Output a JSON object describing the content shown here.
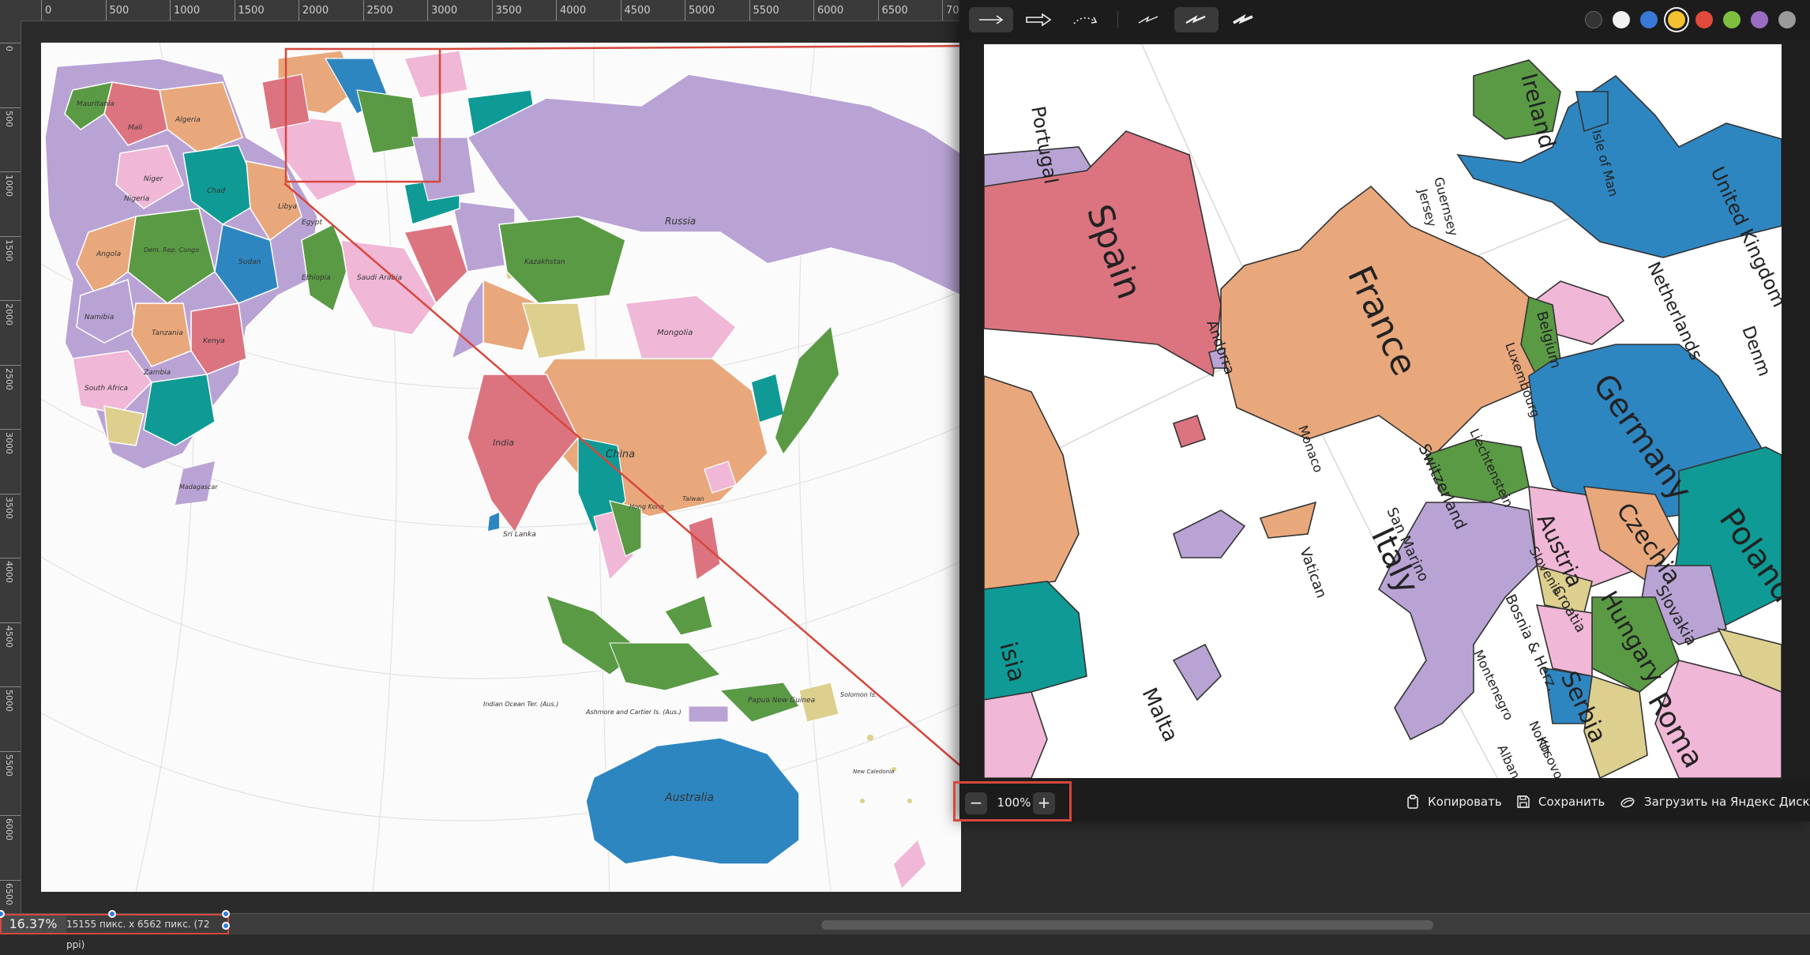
{
  "ruler": {
    "top_labels": [
      "0",
      "500",
      "1000",
      "1500",
      "2000",
      "2500",
      "3000",
      "3500",
      "4000",
      "4500",
      "5000",
      "5500",
      "6000",
      "6500",
      "70"
    ],
    "left_labels": [
      "0",
      "500",
      "1000",
      "1500",
      "2000",
      "2500",
      "3000",
      "3500",
      "4000",
      "4500",
      "5000",
      "5500",
      "6000",
      "6500"
    ]
  },
  "status": {
    "zoom": "16.37%",
    "doc_info": "15155 пикс. x 6562 пикс. (72 ppi)"
  },
  "map_labels": {
    "russia": "Russia",
    "china": "China",
    "india": "India",
    "mongolia": "Mongolia",
    "australia": "Australia",
    "kazakhstan": "Kazakhstan",
    "saudi_arabia": "Saudi Arabia",
    "algeria": "Algeria",
    "mali": "Mali",
    "niger": "Niger",
    "chad": "Chad",
    "sudan": "Sudan",
    "libya": "Libya",
    "egypt": "Egypt",
    "ethiopia": "Ethiopia",
    "kenya": "Kenya",
    "tanzania": "Tanzania",
    "angola": "Angola",
    "zambia": "Zambia",
    "namibia": "Namibia",
    "south_africa": "South Africa",
    "madagascar": "Madagascar",
    "nigeria": "Nigeria",
    "mauritania": "Mauritania",
    "dr_congo": "Dem. Rep. Congo",
    "sri_lanka": "Sri Lanka",
    "papua": "Papua New Guinea",
    "hong_kong": "Hong Kong",
    "taiwan": "Taiwan",
    "indian_ocean": "Indian Ocean Ter. (Aus.)",
    "ashmore": "Ashmore and Cartier Is. (Aus.)",
    "solomon": "Solomon Is.",
    "new_caledonia": "New Caledonia"
  },
  "toolbar": {
    "tools": [
      {
        "name": "arrow-tool",
        "active": true
      },
      {
        "name": "thick-arrow-tool",
        "active": false
      },
      {
        "name": "curve-arrow-tool",
        "active": false
      },
      {
        "name": "pencil-tool",
        "active": false
      },
      {
        "name": "marker-tool",
        "active": true
      },
      {
        "name": "brush-tool",
        "active": false
      }
    ],
    "colors": [
      {
        "name": "dark",
        "hex": "#333333"
      },
      {
        "name": "white",
        "hex": "#f2f2f2"
      },
      {
        "name": "blue",
        "hex": "#3a78d8"
      },
      {
        "name": "yellow",
        "hex": "#f2c230",
        "selected": true
      },
      {
        "name": "red",
        "hex": "#e24a3b"
      },
      {
        "name": "green",
        "hex": "#7fbf3f"
      },
      {
        "name": "purple",
        "hex": "#9a6cc2"
      },
      {
        "name": "gray",
        "hex": "#9a9a9a"
      }
    ]
  },
  "preview_labels": {
    "portugal": "Portugal",
    "spain": "Spain",
    "france": "France",
    "andorra": "Andorra",
    "monaco": "Monaco",
    "ireland": "Ireland",
    "isle_of_man": "Isle of Man",
    "guernsey": "Guernsey",
    "jersey": "Jersey",
    "uk": "United Kingdom",
    "netherlands": "Netherlands",
    "belgium": "Belgium",
    "luxembourg": "Luxembourg",
    "germany": "Germany",
    "denmark": "Denm",
    "switzerland": "Switzerland",
    "liechtenstein": "Liechtenstein",
    "austria": "Austria",
    "czechia": "Czechia",
    "poland": "Poland",
    "slovakia": "Slovakia",
    "hungary": "Hungary",
    "slovenia": "Slovenia",
    "croatia": "Croatia",
    "bosnia": "Bosnia & Herz.",
    "serbia": "Serbia",
    "montenegro": "Montenegro",
    "kosovo": "Kosovo",
    "albania": "Alban",
    "north_mac": "North",
    "romania": "Roma",
    "italy": "Italy",
    "san_marino": "San Marino",
    "vatican": "Vatican",
    "malta": "Malta",
    "tunisia": "isia"
  },
  "bottombar": {
    "zoom_out": "−",
    "zoom_value": "100%",
    "zoom_in": "+",
    "copy": "Копировать",
    "save": "Сохранить",
    "upload": "Загрузить на Яндекс Диск"
  },
  "colors": {
    "pink": "#f0b7d6",
    "red": "#dc7480",
    "orange": "#e8a87c",
    "green": "#5a9a45",
    "blue": "#2e86c1",
    "purple": "#b9a3d4",
    "teal": "#0f9a95",
    "khaki": "#ddcf8e",
    "annotation": "#d6473c"
  }
}
